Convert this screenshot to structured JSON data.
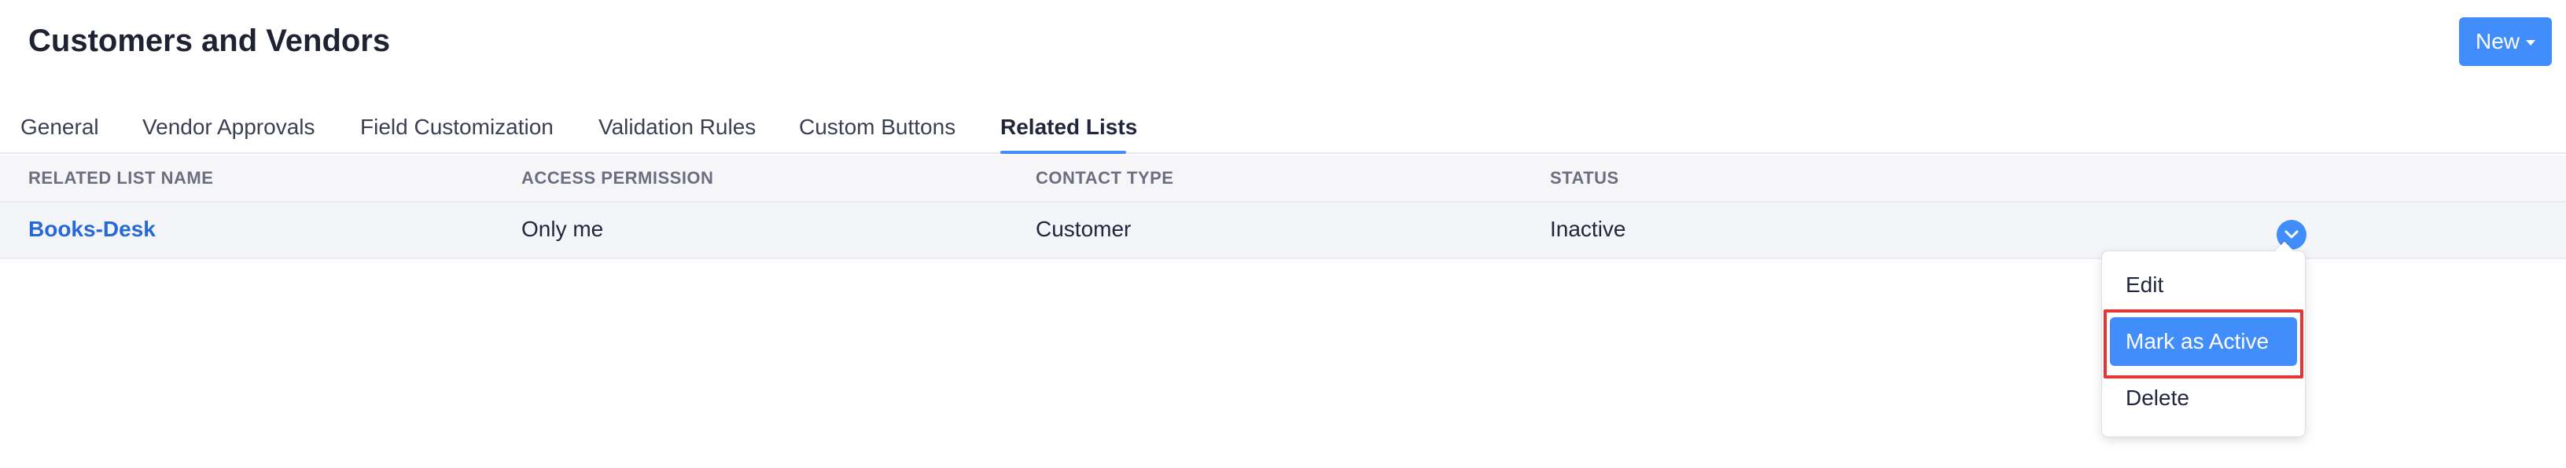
{
  "header": {
    "title": "Customers and Vendors",
    "new_button_label": "New"
  },
  "tabs": [
    {
      "label": "General",
      "active": false
    },
    {
      "label": "Vendor Approvals",
      "active": false
    },
    {
      "label": "Field Customization",
      "active": false
    },
    {
      "label": "Validation Rules",
      "active": false
    },
    {
      "label": "Custom Buttons",
      "active": false
    },
    {
      "label": "Related Lists",
      "active": true
    }
  ],
  "table": {
    "columns": [
      "RELATED LIST NAME",
      "ACCESS PERMISSION",
      "CONTACT TYPE",
      "STATUS"
    ],
    "rows": [
      {
        "name": "Books-Desk",
        "access": "Only me",
        "contact_type": "Customer",
        "status": "Inactive"
      }
    ]
  },
  "row_menu": {
    "icon": "chevron-down-icon",
    "items": [
      "Edit",
      "Mark as Active",
      "Delete"
    ],
    "highlighted_index": 1
  },
  "colors": {
    "accent": "#408dfb",
    "link": "#2668d8",
    "highlight_outline": "#e53535"
  }
}
